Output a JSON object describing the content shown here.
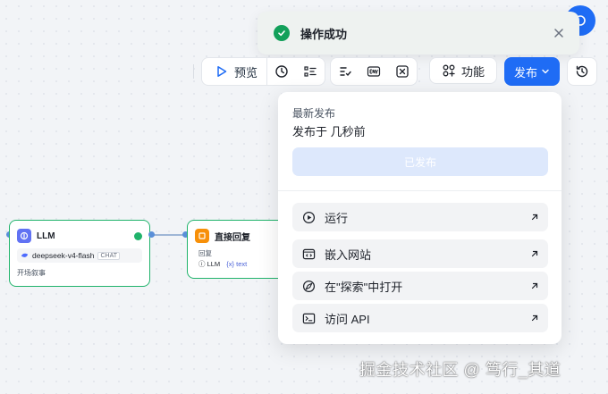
{
  "toast": {
    "message": "操作成功",
    "ghost_text": ""
  },
  "toolbar": {
    "preview_label": "预览",
    "features_label": "功能",
    "publish_label": "发布"
  },
  "nodes": {
    "llm": {
      "title": "LLM",
      "model": "deepseek-v4-flash",
      "model_tag": "CHAT",
      "footer": "开场叙事"
    },
    "reply": {
      "title": "直接回复",
      "label": "回复",
      "ref_source": "LLM",
      "ref_var": "text"
    }
  },
  "publish_panel": {
    "title": "最新发布",
    "subtitle": "发布于 几秒前",
    "published_button": "已发布",
    "actions": [
      {
        "label": "运行",
        "icon": "play-icon"
      },
      {
        "label": "嵌入网站",
        "icon": "embed-icon"
      },
      {
        "label": "在\"探索\"中打开",
        "icon": "compass-icon"
      },
      {
        "label": "访问 API",
        "icon": "terminal-icon"
      }
    ]
  },
  "colors": {
    "accent": "#1f6cf5",
    "success": "#12a05a"
  },
  "watermark": "掘金技术社区 @ 笃行_其道"
}
